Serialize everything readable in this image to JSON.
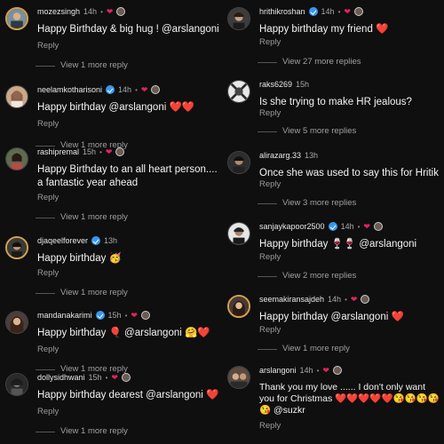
{
  "left_comments": [
    {
      "username": "mozezsingh",
      "time": "14h",
      "text": "Happy Birthday & big hug ! @arslangoni",
      "reply": "Reply",
      "more": "View 1 more reply",
      "verified": false
    },
    {
      "username": "neelamkotharisoni",
      "time": "14h",
      "text": "Happy birthday @arslangoni ❤️❤️",
      "reply": "Reply",
      "more": "View 1 more reply",
      "verified": true
    },
    {
      "username": "rashipremal",
      "time": "15h",
      "text": "Happy Birthday to an all heart person.... a fantastic year ahead",
      "reply": "Reply",
      "more": "View 1 more reply",
      "verified": false
    },
    {
      "username": "djaqeelforever",
      "time": "13h",
      "text": "Happy birthday 🥳",
      "reply": "Reply",
      "more": "View 1 more reply",
      "verified": true
    },
    {
      "username": "mandanakarimi",
      "time": "15h",
      "text": "Happy birthday 🎈 @arslangoni 🤗❤️",
      "reply": "Reply",
      "more": "View 1 more reply",
      "verified": true
    },
    {
      "username": "dollysidhwani",
      "time": "15h",
      "text": "Happy birthday dearest @arslangoni ❤️",
      "reply": "Reply",
      "more": "View 1 more reply",
      "verified": false
    }
  ],
  "right_comments": [
    {
      "username": "hrithikroshan",
      "time": "14h",
      "text": "Happy birthday my friend ❤️",
      "reply": "Reply",
      "more": "View 27 more replies",
      "verified": true
    },
    {
      "username": "raks6269",
      "time": "15h",
      "text": "Is she trying to make HR jealous?",
      "reply": "Reply",
      "more": "View 5 more replies",
      "verified": false
    },
    {
      "username": "alirazarg.33",
      "time": "13h",
      "text": "Once she was used to say this for Hritik",
      "reply": "Reply",
      "more": "View 3 more replies",
      "verified": false
    },
    {
      "username": "sanjaykapoor2500",
      "time": "14h",
      "text": "Happy birthday 🍷🍷 @arslangoni",
      "reply": "Reply",
      "more": "View 2 more replies",
      "verified": true
    },
    {
      "username": "seemakiransajdeh",
      "time": "14h",
      "text": "Happy birthday @arslangoni ❤️",
      "reply": "Reply",
      "more": "View 1 more reply",
      "verified": true
    },
    {
      "username": "arslangoni",
      "time": "14h",
      "text": "Thank you my love ...... I don't only want you for Christmas ❤️❤️❤️❤️❤️😘😘😘😘😘 @suzkr",
      "reply": "Reply",
      "more": "",
      "verified": false
    }
  ],
  "colors": {
    "background": "#0f0f0f",
    "verified": "#3897f0",
    "heart": "#e0245e"
  }
}
